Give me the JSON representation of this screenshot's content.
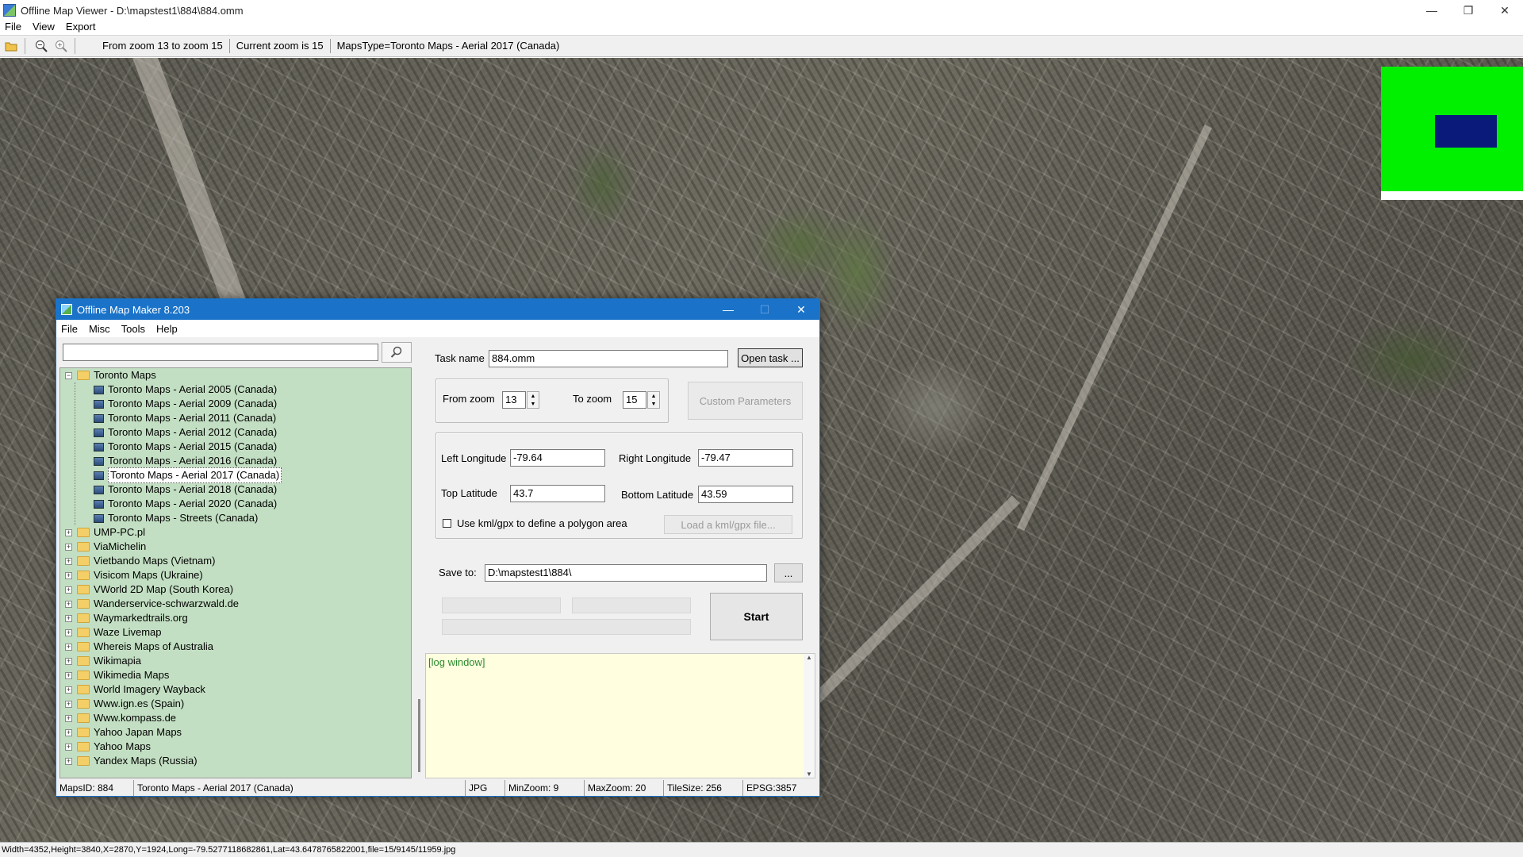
{
  "window": {
    "title": "Offline Map Viewer - D:\\mapstest1\\884\\884.omm",
    "controls": {
      "minimize": "—",
      "restore": "❐",
      "close": "✕"
    }
  },
  "menu": [
    "File",
    "View",
    "Export"
  ],
  "toolbar": {
    "zoom_range": "From zoom 13 to zoom 15",
    "current_zoom": "Current zoom is 15",
    "maps_type": "MapsType=Toronto Maps - Aerial 2017 (Canada)"
  },
  "status_bar": "Width=4352,Height=3840,X=2870,Y=1924,Long=-79.5277118682861,Lat=43.6478765822001,file=15/9145/11959.jpg",
  "dialog": {
    "title": "Offline Map Maker 8.203",
    "controls": {
      "minimize": "—",
      "maximize": "☐",
      "close": "✕"
    },
    "menu": [
      "File",
      "Misc",
      "Tools",
      "Help"
    ],
    "search_placeholder": "",
    "tree": {
      "root": "Toronto Maps",
      "children": [
        "Toronto Maps - Aerial 2005 (Canada)",
        "Toronto Maps - Aerial 2009 (Canada)",
        "Toronto Maps - Aerial 2011 (Canada)",
        "Toronto Maps - Aerial 2012 (Canada)",
        "Toronto Maps - Aerial 2015 (Canada)",
        "Toronto Maps - Aerial 2016 (Canada)",
        "Toronto Maps - Aerial 2017 (Canada)",
        "Toronto Maps - Aerial 2018 (Canada)",
        "Toronto Maps - Aerial 2020 (Canada)",
        "Toronto Maps - Streets (Canada)"
      ],
      "selected_index": 6,
      "folders": [
        "UMP-PC.pl",
        "ViaMichelin",
        "Vietbando Maps (Vietnam)",
        "Visicom Maps (Ukraine)",
        "VWorld 2D Map (South Korea)",
        "Wanderservice-schwarzwald.de",
        "Waymarkedtrails.org",
        "Waze Livemap",
        "Whereis Maps of Australia",
        "Wikimapia",
        "Wikimedia Maps",
        "World Imagery Wayback",
        "Www.ign.es (Spain)",
        "Www.kompass.de",
        "Yahoo Japan Maps",
        "Yahoo Maps",
        "Yandex Maps (Russia)"
      ]
    },
    "task_name_label": "Task name",
    "task_name_value": "884.omm",
    "open_task": "Open task ...",
    "from_zoom_label": "From zoom",
    "from_zoom_value": "13",
    "to_zoom_label": "To zoom",
    "to_zoom_value": "15",
    "custom_params": "Custom Parameters",
    "left_lon_label": "Left Longitude",
    "left_lon_value": "-79.64",
    "right_lon_label": "Right Longitude",
    "right_lon_value": "-79.47",
    "top_lat_label": "Top Latitude",
    "top_lat_value": "43.7",
    "bottom_lat_label": "Bottom Latitude",
    "bottom_lat_value": "43.59",
    "kml_checkbox_label": "Use kml/gpx to define a polygon area",
    "load_kml": "Load a kml/gpx file...",
    "save_to_label": "Save to:",
    "save_to_value": "D:\\mapstest1\\884\\",
    "browse": "...",
    "start": "Start",
    "log_text": "[log window]",
    "status": {
      "maps_id": "MapsID: 884",
      "map_name": "Toronto Maps - Aerial 2017 (Canada)",
      "format": "JPG",
      "min_zoom": "MinZoom: 9",
      "max_zoom": "MaxZoom: 20",
      "tile_size": "TileSize: 256",
      "epsg": "EPSG:3857"
    }
  },
  "colors": {
    "dialog_accent": "#1a73c9",
    "tree_bg": "#c3dfc3",
    "log_bg": "#ffffe0",
    "minimap_green": "#00f000",
    "minimap_view": "#0a1a7a"
  }
}
